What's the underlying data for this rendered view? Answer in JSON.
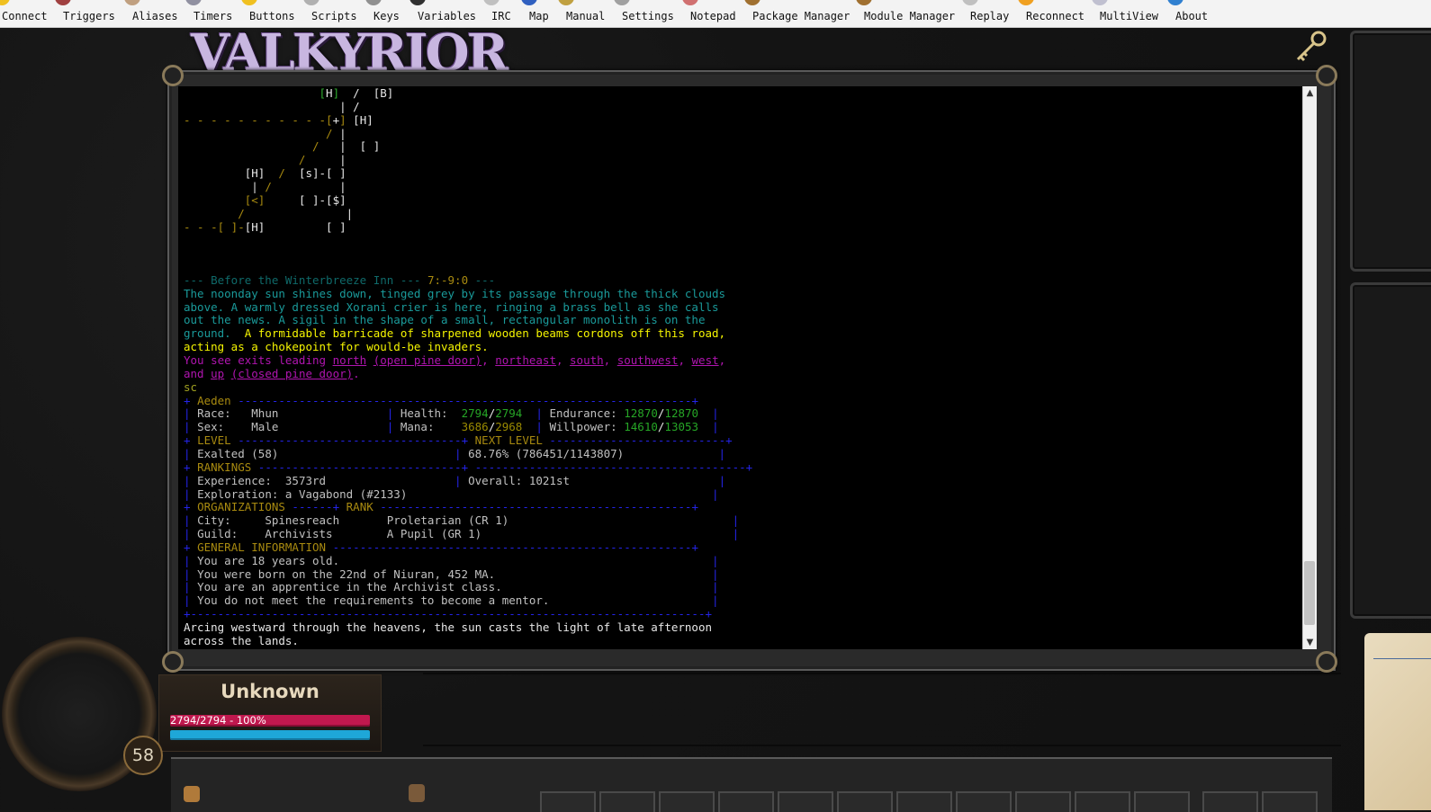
{
  "toolbar": {
    "items": [
      {
        "label": "Connect",
        "icon": "connect-icon",
        "color": "#f0c020"
      },
      {
        "label": "Triggers",
        "icon": "triggers-icon",
        "color": "#a04040"
      },
      {
        "label": "Aliases",
        "icon": "aliases-icon",
        "color": "#c0a080"
      },
      {
        "label": "Timers",
        "icon": "timers-icon",
        "color": "#9090a0"
      },
      {
        "label": "Buttons",
        "icon": "buttons-icon",
        "color": "#f0c020"
      },
      {
        "label": "Scripts",
        "icon": "scripts-icon",
        "color": "#b0b0b0"
      },
      {
        "label": "Keys",
        "icon": "keys-icon",
        "color": "#909090"
      },
      {
        "label": "Variables",
        "icon": "variables-icon",
        "color": "#303030"
      },
      {
        "label": "IRC",
        "icon": "irc-icon",
        "color": "#c0c0c0"
      },
      {
        "label": "Map",
        "icon": "map-icon",
        "color": "#3060c0"
      },
      {
        "label": "Manual",
        "icon": "manual-icon",
        "color": "#c0a040"
      },
      {
        "label": "Settings",
        "icon": "settings-icon",
        "color": "#a0a0a0"
      },
      {
        "label": "Notepad",
        "icon": "notepad-icon",
        "color": "#d07070"
      },
      {
        "label": "Package Manager",
        "icon": "package-manager-icon",
        "color": "#a07030"
      },
      {
        "label": "Module Manager",
        "icon": "module-manager-icon",
        "color": "#a07030"
      },
      {
        "label": "Replay",
        "icon": "replay-icon",
        "color": "#c0c0c0"
      },
      {
        "label": "Reconnect",
        "icon": "reconnect-icon",
        "color": "#f0a020"
      },
      {
        "label": "MultiView",
        "icon": "multiview-icon",
        "color": "#c0c0d0"
      },
      {
        "label": "About",
        "icon": "about-icon",
        "color": "#3080d0"
      }
    ]
  },
  "logo": {
    "text": "VALKYRIOR"
  },
  "map": {
    "lines": [
      [
        {
          "t": "                    ",
          "c": "c-grey"
        },
        {
          "t": "[",
          "c": "c-green"
        },
        {
          "t": "H",
          "c": "c-white"
        },
        {
          "t": "]",
          "c": "c-green"
        },
        {
          "t": "  /  ",
          "c": "c-white"
        },
        {
          "t": "[B]",
          "c": "c-white"
        }
      ],
      [
        {
          "t": "                       | /",
          "c": "c-white"
        }
      ],
      [
        {
          "t": "- - - - - - - - - - -",
          "c": "c-gold"
        },
        {
          "t": "[",
          "c": "c-gold"
        },
        {
          "t": "+",
          "c": "c-white"
        },
        {
          "t": "]",
          "c": "c-gold"
        },
        {
          "t": " [H]",
          "c": "c-white"
        }
      ],
      [
        {
          "t": "                     / ",
          "c": "c-gold"
        },
        {
          "t": "|",
          "c": "c-white"
        }
      ],
      [
        {
          "t": "                   / ",
          "c": "c-gold"
        },
        {
          "t": "  |  [ ]",
          "c": "c-white"
        }
      ],
      [
        {
          "t": "                 / ",
          "c": "c-gold"
        },
        {
          "t": "    |",
          "c": "c-white"
        }
      ],
      [
        {
          "t": "         [H]  ",
          "c": "c-white"
        },
        {
          "t": "/",
          "c": "c-gold"
        },
        {
          "t": "  [s]-[ ]",
          "c": "c-white"
        }
      ],
      [
        {
          "t": "          | ",
          "c": "c-white"
        },
        {
          "t": "/",
          "c": "c-gold"
        },
        {
          "t": "          |",
          "c": "c-white"
        }
      ],
      [
        {
          "t": "         ",
          "c": "c-white"
        },
        {
          "t": "[<]",
          "c": "c-gold"
        },
        {
          "t": "     [ ]-[$]",
          "c": "c-white"
        }
      ],
      [
        {
          "t": "        / ",
          "c": "c-gold"
        },
        {
          "t": "              |",
          "c": "c-white"
        }
      ],
      [
        {
          "t": "- - -[ ]-",
          "c": "c-gold"
        },
        {
          "t": "[H]",
          "c": "c-white"
        },
        {
          "t": "         [ ]",
          "c": "c-white"
        }
      ]
    ]
  },
  "room": {
    "title_line": [
      {
        "t": "--- Before the Winterbreeze Inn --- ",
        "c": "c-dcyan"
      },
      {
        "t": "7:-9:0",
        "c": "c-gold"
      },
      {
        "t": " ---",
        "c": "c-dcyan"
      }
    ],
    "desc": [
      [
        {
          "t": "The noonday sun shines down, tinged grey by its passage through the thick clouds",
          "c": "c-cyan"
        }
      ],
      [
        {
          "t": "above. A warmly dressed Xorani crier is here, ringing a brass bell as she calls",
          "c": "c-cyan"
        }
      ],
      [
        {
          "t": "out the news. A sigil in the shape of a small, rectangular monolith is on the",
          "c": "c-cyan"
        }
      ],
      [
        {
          "t": "ground.  ",
          "c": "c-cyan"
        },
        {
          "t": "A formidable barricade of sharpened wooden beams cordons off this road,",
          "c": "c-yellow"
        }
      ],
      [
        {
          "t": "acting as a chokepoint for would-be invaders.",
          "c": "c-yellow"
        }
      ],
      [
        {
          "t": "You see exits leading ",
          "c": "c-magenta"
        },
        {
          "t": "north",
          "c": "c-magu"
        },
        {
          "t": " ",
          "c": "c-magenta"
        },
        {
          "t": "(open pine door)",
          "c": "c-magu"
        },
        {
          "t": ", ",
          "c": "c-magenta"
        },
        {
          "t": "northeast",
          "c": "c-magu"
        },
        {
          "t": ", ",
          "c": "c-magenta"
        },
        {
          "t": "south",
          "c": "c-magu"
        },
        {
          "t": ", ",
          "c": "c-magenta"
        },
        {
          "t": "southwest",
          "c": "c-magu"
        },
        {
          "t": ", ",
          "c": "c-magenta"
        },
        {
          "t": "west",
          "c": "c-magu"
        },
        {
          "t": ",",
          "c": "c-magenta"
        }
      ],
      [
        {
          "t": "and ",
          "c": "c-magenta"
        },
        {
          "t": "up",
          "c": "c-magu"
        },
        {
          "t": " ",
          "c": "c-magenta"
        },
        {
          "t": "(closed pine door)",
          "c": "c-magu"
        },
        {
          "t": ".",
          "c": "c-magenta"
        }
      ],
      [
        {
          "t": "sc",
          "c": "c-olive"
        }
      ]
    ]
  },
  "score": [
    [
      {
        "t": "+ ",
        "c": "c-blue"
      },
      {
        "t": "Aeden",
        "c": "c-gold"
      },
      {
        "t": " -------------------------------------------------------------------+",
        "c": "c-blue"
      }
    ],
    [
      {
        "t": "| ",
        "c": "c-blue"
      },
      {
        "t": "Race:   Mhun                ",
        "c": "c-grey"
      },
      {
        "t": "| ",
        "c": "c-blue"
      },
      {
        "t": "Health:  ",
        "c": "c-grey"
      },
      {
        "t": "2794",
        "c": "c-hgreen"
      },
      {
        "t": "/",
        "c": "c-white"
      },
      {
        "t": "2794",
        "c": "c-hgreen"
      },
      {
        "t": "  ",
        "c": "c-grey"
      },
      {
        "t": "| ",
        "c": "c-blue"
      },
      {
        "t": "Endurance: ",
        "c": "c-grey"
      },
      {
        "t": "12870",
        "c": "c-hgreen"
      },
      {
        "t": "/",
        "c": "c-white"
      },
      {
        "t": "12870",
        "c": "c-hgreen"
      },
      {
        "t": "  |",
        "c": "c-blue"
      }
    ],
    [
      {
        "t": "| ",
        "c": "c-blue"
      },
      {
        "t": "Sex:    Male                ",
        "c": "c-grey"
      },
      {
        "t": "| ",
        "c": "c-blue"
      },
      {
        "t": "Mana:    ",
        "c": "c-grey"
      },
      {
        "t": "3686",
        "c": "c-ygreen"
      },
      {
        "t": "/",
        "c": "c-white"
      },
      {
        "t": "2968",
        "c": "c-ygreen"
      },
      {
        "t": "  ",
        "c": "c-grey"
      },
      {
        "t": "| ",
        "c": "c-blue"
      },
      {
        "t": "Willpower: ",
        "c": "c-grey"
      },
      {
        "t": "14610",
        "c": "c-hgreen"
      },
      {
        "t": "/",
        "c": "c-white"
      },
      {
        "t": "13053",
        "c": "c-hgreen"
      },
      {
        "t": "  |",
        "c": "c-blue"
      }
    ],
    [
      {
        "t": "+ ",
        "c": "c-blue"
      },
      {
        "t": "LEVEL",
        "c": "c-gold"
      },
      {
        "t": " ---------------------------------+ ",
        "c": "c-blue"
      },
      {
        "t": "NEXT LEVEL",
        "c": "c-gold"
      },
      {
        "t": " --------------------------+",
        "c": "c-blue"
      }
    ],
    [
      {
        "t": "| ",
        "c": "c-blue"
      },
      {
        "t": "Exalted (58)                          ",
        "c": "c-grey"
      },
      {
        "t": "| ",
        "c": "c-blue"
      },
      {
        "t": "68.76% (786451/1143807)",
        "c": "c-grey"
      },
      {
        "t": "              |",
        "c": "c-blue"
      }
    ],
    [
      {
        "t": "+ ",
        "c": "c-blue"
      },
      {
        "t": "RANKINGS",
        "c": "c-gold"
      },
      {
        "t": " ------------------------------+ ----------------------------------------+",
        "c": "c-blue"
      }
    ],
    [
      {
        "t": "| ",
        "c": "c-blue"
      },
      {
        "t": "Experience:  3573rd                   ",
        "c": "c-grey"
      },
      {
        "t": "| ",
        "c": "c-blue"
      },
      {
        "t": "Overall: 1021st",
        "c": "c-grey"
      },
      {
        "t": "                      |",
        "c": "c-blue"
      }
    ],
    [
      {
        "t": "| ",
        "c": "c-blue"
      },
      {
        "t": "Exploration: a Vagabond (#2133)",
        "c": "c-grey"
      },
      {
        "t": "                                             |",
        "c": "c-blue"
      }
    ],
    [
      {
        "t": "+ ",
        "c": "c-blue"
      },
      {
        "t": "ORGANIZATIONS",
        "c": "c-gold"
      },
      {
        "t": " ------+ ",
        "c": "c-blue"
      },
      {
        "t": "RANK",
        "c": "c-gold"
      },
      {
        "t": " ----------------------------------------------+",
        "c": "c-blue"
      }
    ],
    [
      {
        "t": "| ",
        "c": "c-blue"
      },
      {
        "t": "City:     Spinesreach       ",
        "c": "c-grey"
      },
      {
        "t": "Proletarian (CR 1)",
        "c": "c-grey"
      },
      {
        "t": "                                 |",
        "c": "c-blue"
      }
    ],
    [
      {
        "t": "| ",
        "c": "c-blue"
      },
      {
        "t": "Guild:    Archivists        ",
        "c": "c-grey"
      },
      {
        "t": "A Pupil (GR 1)",
        "c": "c-grey"
      },
      {
        "t": "                                     |",
        "c": "c-blue"
      }
    ],
    [
      {
        "t": "+ ",
        "c": "c-blue"
      },
      {
        "t": "GENERAL INFORMATION",
        "c": "c-gold"
      },
      {
        "t": " -----------------------------------------------------+",
        "c": "c-blue"
      }
    ],
    [
      {
        "t": "| ",
        "c": "c-blue"
      },
      {
        "t": "You are 18 years old.",
        "c": "c-grey"
      },
      {
        "t": "                                                       |",
        "c": "c-blue"
      }
    ],
    [
      {
        "t": "| ",
        "c": "c-blue"
      },
      {
        "t": "You were born on the 22nd of Niuran, 452 MA.",
        "c": "c-grey"
      },
      {
        "t": "                                |",
        "c": "c-blue"
      }
    ],
    [
      {
        "t": "| ",
        "c": "c-blue"
      },
      {
        "t": "You are an apprentice in the Archivist class.",
        "c": "c-grey"
      },
      {
        "t": "                               |",
        "c": "c-blue"
      }
    ],
    [
      {
        "t": "| ",
        "c": "c-blue"
      },
      {
        "t": "You do not meet the requirements to become a mentor.",
        "c": "c-grey"
      },
      {
        "t": "                        |",
        "c": "c-blue"
      }
    ],
    [
      {
        "t": "+----------------------------------------------------------------------------+",
        "c": "c-blue"
      }
    ]
  ],
  "footer_lines": [
    [
      {
        "t": "Arcing westward through the heavens, the sun casts the light of late afternoon",
        "c": "c-white"
      }
    ],
    [
      {
        "t": "across the lands.",
        "c": "c-white"
      }
    ]
  ],
  "status": {
    "name": "Unknown",
    "hp_text": "2794/2794 - 100%",
    "hp_fraction": 1.0,
    "mp_fraction": 1.0,
    "level": "58"
  },
  "scroll": {
    "thumb_fraction_start": 0.86,
    "thumb_fraction_size": 0.12
  }
}
